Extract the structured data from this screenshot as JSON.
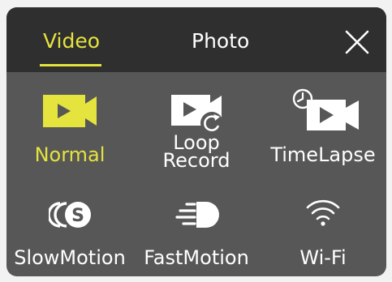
{
  "tabs": {
    "video_label": "Video",
    "photo_label": "Photo",
    "active": "Video"
  },
  "modes": [
    {
      "label": "Normal",
      "icon": "video-camera-icon",
      "active": true
    },
    {
      "label_line1": "Loop",
      "label_line2": "Record",
      "icon": "loop-record-icon",
      "active": false
    },
    {
      "label": "TimeLapse",
      "icon": "timelapse-icon",
      "active": false
    },
    {
      "label": "SlowMotion",
      "icon": "slow-motion-icon",
      "active": false
    },
    {
      "label": "FastMotion",
      "icon": "fast-motion-icon",
      "active": false
    },
    {
      "label": "Wi-Fi",
      "icon": "wifi-icon",
      "active": false
    }
  ],
  "colors": {
    "accent": "#e5e33e",
    "header_bg": "#2f2f2f",
    "body_bg": "#575757",
    "text": "#ffffff"
  }
}
